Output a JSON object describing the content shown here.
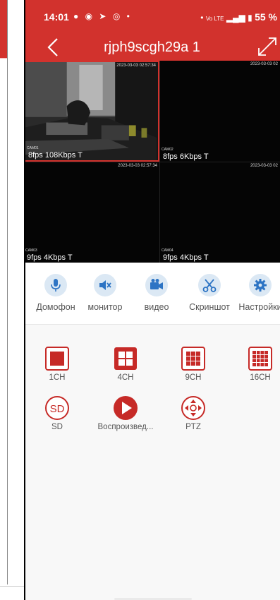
{
  "status_bar": {
    "time": "14:01",
    "icons": [
      "chat-icon",
      "signal-app-icon",
      "navigation-icon",
      "camera-icon",
      "dot-icon"
    ],
    "network": "Vo LTE",
    "battery": "55 %"
  },
  "header": {
    "title": "rjph9scgh29a 1",
    "accent_color": "#d2322d"
  },
  "cameras": [
    {
      "name": "CAM01",
      "timestamp": "2023-03-03 02:57:34",
      "stats": "8fps 108Kbps T",
      "selected": true
    },
    {
      "name": "CAM02",
      "timestamp": "2023-03-03 02",
      "stats": "8fps 6Kbps T",
      "selected": false
    },
    {
      "name": "CAM03",
      "timestamp": "2023-03-03 02:57:34",
      "stats": "9fps 4Kbps T",
      "selected": false
    },
    {
      "name": "CAM04",
      "timestamp": "2023-03-03 02",
      "stats": "9fps 4Kbps T",
      "selected": false
    }
  ],
  "tools": [
    {
      "label": "Домофон",
      "icon": "microphone-icon"
    },
    {
      "label": "монитор",
      "icon": "speaker-mute-icon"
    },
    {
      "label": "видео",
      "icon": "video-record-icon"
    },
    {
      "label": "Скриншот",
      "icon": "scissors-icon"
    },
    {
      "label": "Настройки",
      "icon": "gear-icon"
    }
  ],
  "layout_buttons": [
    {
      "label": "1CH",
      "icon": "single-view-icon"
    },
    {
      "label": "4CH",
      "icon": "quad-view-icon"
    },
    {
      "label": "9CH",
      "icon": "nine-view-icon"
    },
    {
      "label": "16CH",
      "icon": "sixteen-view-icon"
    }
  ],
  "function_buttons": [
    {
      "label": "SD",
      "icon": "sd-card-icon"
    },
    {
      "label": "Воспроизвед...",
      "icon": "playback-icon"
    },
    {
      "label": "PTZ",
      "icon": "ptz-control-icon"
    }
  ]
}
